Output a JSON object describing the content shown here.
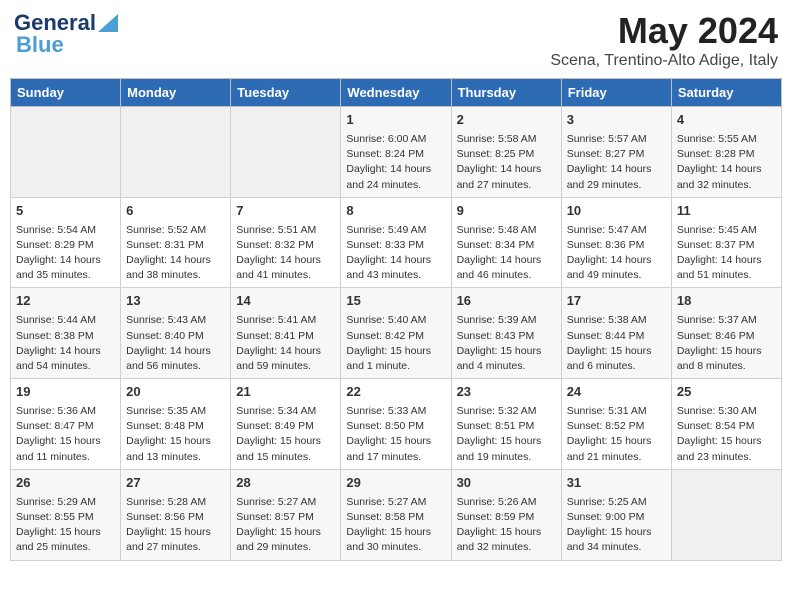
{
  "header": {
    "logo_line1": "General",
    "logo_line2": "Blue",
    "month": "May 2024",
    "location": "Scena, Trentino-Alto Adige, Italy"
  },
  "days_of_week": [
    "Sunday",
    "Monday",
    "Tuesday",
    "Wednesday",
    "Thursday",
    "Friday",
    "Saturday"
  ],
  "weeks": [
    [
      {
        "day": "",
        "sunrise": "",
        "sunset": "",
        "daylight": ""
      },
      {
        "day": "",
        "sunrise": "",
        "sunset": "",
        "daylight": ""
      },
      {
        "day": "",
        "sunrise": "",
        "sunset": "",
        "daylight": ""
      },
      {
        "day": "1",
        "sunrise": "Sunrise: 6:00 AM",
        "sunset": "Sunset: 8:24 PM",
        "daylight": "Daylight: 14 hours and 24 minutes."
      },
      {
        "day": "2",
        "sunrise": "Sunrise: 5:58 AM",
        "sunset": "Sunset: 8:25 PM",
        "daylight": "Daylight: 14 hours and 27 minutes."
      },
      {
        "day": "3",
        "sunrise": "Sunrise: 5:57 AM",
        "sunset": "Sunset: 8:27 PM",
        "daylight": "Daylight: 14 hours and 29 minutes."
      },
      {
        "day": "4",
        "sunrise": "Sunrise: 5:55 AM",
        "sunset": "Sunset: 8:28 PM",
        "daylight": "Daylight: 14 hours and 32 minutes."
      }
    ],
    [
      {
        "day": "5",
        "sunrise": "Sunrise: 5:54 AM",
        "sunset": "Sunset: 8:29 PM",
        "daylight": "Daylight: 14 hours and 35 minutes."
      },
      {
        "day": "6",
        "sunrise": "Sunrise: 5:52 AM",
        "sunset": "Sunset: 8:31 PM",
        "daylight": "Daylight: 14 hours and 38 minutes."
      },
      {
        "day": "7",
        "sunrise": "Sunrise: 5:51 AM",
        "sunset": "Sunset: 8:32 PM",
        "daylight": "Daylight: 14 hours and 41 minutes."
      },
      {
        "day": "8",
        "sunrise": "Sunrise: 5:49 AM",
        "sunset": "Sunset: 8:33 PM",
        "daylight": "Daylight: 14 hours and 43 minutes."
      },
      {
        "day": "9",
        "sunrise": "Sunrise: 5:48 AM",
        "sunset": "Sunset: 8:34 PM",
        "daylight": "Daylight: 14 hours and 46 minutes."
      },
      {
        "day": "10",
        "sunrise": "Sunrise: 5:47 AM",
        "sunset": "Sunset: 8:36 PM",
        "daylight": "Daylight: 14 hours and 49 minutes."
      },
      {
        "day": "11",
        "sunrise": "Sunrise: 5:45 AM",
        "sunset": "Sunset: 8:37 PM",
        "daylight": "Daylight: 14 hours and 51 minutes."
      }
    ],
    [
      {
        "day": "12",
        "sunrise": "Sunrise: 5:44 AM",
        "sunset": "Sunset: 8:38 PM",
        "daylight": "Daylight: 14 hours and 54 minutes."
      },
      {
        "day": "13",
        "sunrise": "Sunrise: 5:43 AM",
        "sunset": "Sunset: 8:40 PM",
        "daylight": "Daylight: 14 hours and 56 minutes."
      },
      {
        "day": "14",
        "sunrise": "Sunrise: 5:41 AM",
        "sunset": "Sunset: 8:41 PM",
        "daylight": "Daylight: 14 hours and 59 minutes."
      },
      {
        "day": "15",
        "sunrise": "Sunrise: 5:40 AM",
        "sunset": "Sunset: 8:42 PM",
        "daylight": "Daylight: 15 hours and 1 minute."
      },
      {
        "day": "16",
        "sunrise": "Sunrise: 5:39 AM",
        "sunset": "Sunset: 8:43 PM",
        "daylight": "Daylight: 15 hours and 4 minutes."
      },
      {
        "day": "17",
        "sunrise": "Sunrise: 5:38 AM",
        "sunset": "Sunset: 8:44 PM",
        "daylight": "Daylight: 15 hours and 6 minutes."
      },
      {
        "day": "18",
        "sunrise": "Sunrise: 5:37 AM",
        "sunset": "Sunset: 8:46 PM",
        "daylight": "Daylight: 15 hours and 8 minutes."
      }
    ],
    [
      {
        "day": "19",
        "sunrise": "Sunrise: 5:36 AM",
        "sunset": "Sunset: 8:47 PM",
        "daylight": "Daylight: 15 hours and 11 minutes."
      },
      {
        "day": "20",
        "sunrise": "Sunrise: 5:35 AM",
        "sunset": "Sunset: 8:48 PM",
        "daylight": "Daylight: 15 hours and 13 minutes."
      },
      {
        "day": "21",
        "sunrise": "Sunrise: 5:34 AM",
        "sunset": "Sunset: 8:49 PM",
        "daylight": "Daylight: 15 hours and 15 minutes."
      },
      {
        "day": "22",
        "sunrise": "Sunrise: 5:33 AM",
        "sunset": "Sunset: 8:50 PM",
        "daylight": "Daylight: 15 hours and 17 minutes."
      },
      {
        "day": "23",
        "sunrise": "Sunrise: 5:32 AM",
        "sunset": "Sunset: 8:51 PM",
        "daylight": "Daylight: 15 hours and 19 minutes."
      },
      {
        "day": "24",
        "sunrise": "Sunrise: 5:31 AM",
        "sunset": "Sunset: 8:52 PM",
        "daylight": "Daylight: 15 hours and 21 minutes."
      },
      {
        "day": "25",
        "sunrise": "Sunrise: 5:30 AM",
        "sunset": "Sunset: 8:54 PM",
        "daylight": "Daylight: 15 hours and 23 minutes."
      }
    ],
    [
      {
        "day": "26",
        "sunrise": "Sunrise: 5:29 AM",
        "sunset": "Sunset: 8:55 PM",
        "daylight": "Daylight: 15 hours and 25 minutes."
      },
      {
        "day": "27",
        "sunrise": "Sunrise: 5:28 AM",
        "sunset": "Sunset: 8:56 PM",
        "daylight": "Daylight: 15 hours and 27 minutes."
      },
      {
        "day": "28",
        "sunrise": "Sunrise: 5:27 AM",
        "sunset": "Sunset: 8:57 PM",
        "daylight": "Daylight: 15 hours and 29 minutes."
      },
      {
        "day": "29",
        "sunrise": "Sunrise: 5:27 AM",
        "sunset": "Sunset: 8:58 PM",
        "daylight": "Daylight: 15 hours and 30 minutes."
      },
      {
        "day": "30",
        "sunrise": "Sunrise: 5:26 AM",
        "sunset": "Sunset: 8:59 PM",
        "daylight": "Daylight: 15 hours and 32 minutes."
      },
      {
        "day": "31",
        "sunrise": "Sunrise: 5:25 AM",
        "sunset": "Sunset: 9:00 PM",
        "daylight": "Daylight: 15 hours and 34 minutes."
      },
      {
        "day": "",
        "sunrise": "",
        "sunset": "",
        "daylight": ""
      }
    ]
  ]
}
